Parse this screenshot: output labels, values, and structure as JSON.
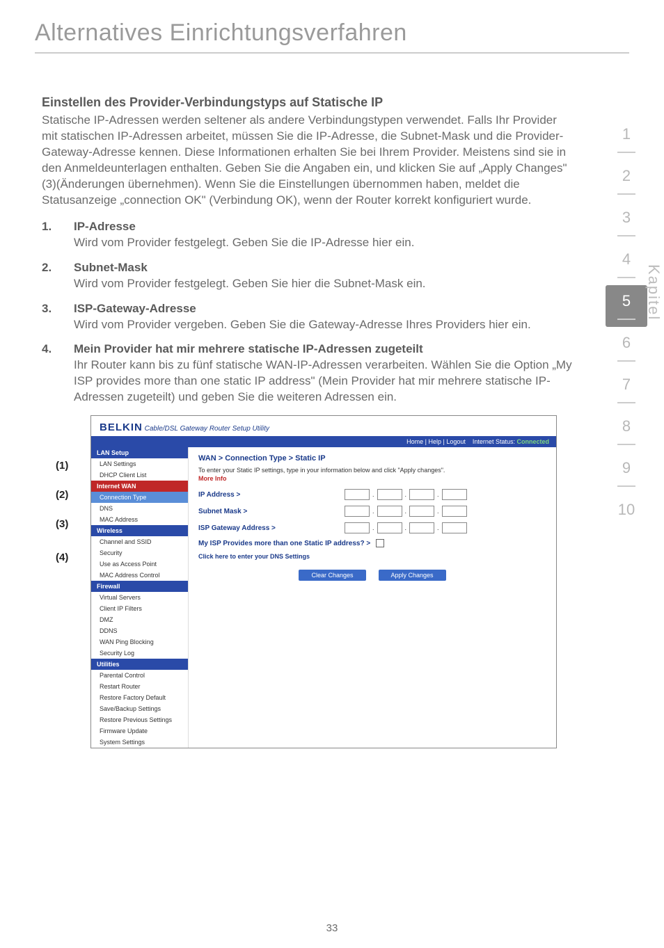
{
  "page_title": "Alternatives Einrichtungsverfahren",
  "section_heading": "Einstellen des Provider-Verbindungstyps auf Statische IP",
  "intro": "Statische IP-Adressen werden seltener als andere Verbindungstypen verwendet. Falls Ihr Provider mit statischen IP-Adressen arbeitet, müssen Sie die IP-Adresse, die Subnet-Mask und die Provider-Gateway-Adresse kennen. Diese Informationen erhalten Sie bei Ihrem Provider. Meistens sind sie in den Anmeldeunterlagen enthalten. Geben Sie die Angaben ein, und klicken Sie auf „Apply Changes\" (3)(Änderungen übernehmen). Wenn Sie die Einstellungen übernommen haben, meldet die Statusanzeige „connection OK\" (Verbindung OK), wenn der Router korrekt konfiguriert wurde.",
  "items": [
    {
      "num": "1.",
      "title": "IP-Adresse",
      "text": "Wird vom Provider festgelegt. Geben Sie die IP-Adresse hier ein."
    },
    {
      "num": "2.",
      "title": "Subnet-Mask",
      "text": "Wird vom Provider festgelegt. Geben Sie hier die Subnet-Mask ein."
    },
    {
      "num": "3.",
      "title": "ISP-Gateway-Adresse",
      "text": "Wird vom Provider vergeben. Geben Sie die Gateway-Adresse Ihres Providers hier ein."
    },
    {
      "num": "4.",
      "title": "Mein Provider hat mir mehrere statische IP-Adressen zugeteilt",
      "text": "Ihr Router kann bis zu fünf statische WAN-IP-Adressen verarbeiten. Wählen Sie die Option „My ISP provides more than one static IP address\" (Mein Provider hat mir mehrere statische IP-Adressen zugeteilt) und geben Sie die weiteren Adressen ein."
    }
  ],
  "side_tabs": [
    "1",
    "2",
    "3",
    "4",
    "5",
    "6",
    "7",
    "8",
    "9",
    "10"
  ],
  "active_tab": "5",
  "kapitel": "Kapitel",
  "callouts": [
    "(1)",
    "(2)",
    "(3)",
    "(4)"
  ],
  "router": {
    "logo": "BELKIN",
    "logo_sub": "Cable/DSL Gateway Router Setup Utility",
    "status_links": "Home | Help | Logout",
    "status_label": "Internet Status:",
    "status_value": "Connected",
    "nav": {
      "lan_setup": "LAN Setup",
      "lan_items": [
        "LAN Settings",
        "DHCP Client List"
      ],
      "internet_wan": "Internet WAN",
      "wan_items": [
        "Connection Type",
        "DNS",
        "MAC Address"
      ],
      "wireless": "Wireless",
      "wireless_items": [
        "Channel and SSID",
        "Security",
        "Use as Access Point",
        "MAC Address Control"
      ],
      "firewall": "Firewall",
      "firewall_items": [
        "Virtual Servers",
        "Client IP Filters",
        "DMZ",
        "DDNS",
        "WAN Ping Blocking",
        "Security Log"
      ],
      "utilities": "Utilities",
      "utilities_items": [
        "Parental Control",
        "Restart Router",
        "Restore Factory Default",
        "Save/Backup Settings",
        "Restore Previous Settings",
        "Firmware Update",
        "System Settings"
      ]
    },
    "breadcrumb": "WAN > Connection Type > Static IP",
    "instruct": "To enter your Static IP settings, type in your information below and click \"Apply changes\".",
    "more_info": "More Info",
    "labels": {
      "ip": "IP Address >",
      "subnet": "Subnet Mask >",
      "gateway": "ISP Gateway Address >",
      "multi": "My ISP Provides more than one Static IP address? >",
      "dns": "Click here to enter your DNS Settings"
    },
    "buttons": {
      "clear": "Clear Changes",
      "apply": "Apply Changes"
    }
  },
  "page_number": "33"
}
